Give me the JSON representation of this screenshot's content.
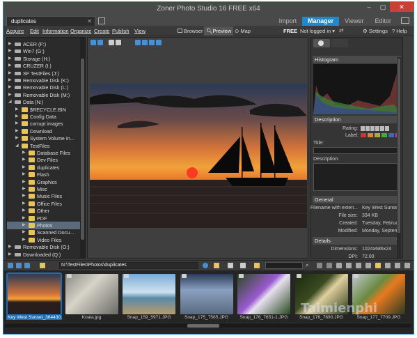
{
  "app": {
    "title": "Zoner Photo Studio 16 FREE x64",
    "doc_tab": "duplicates"
  },
  "modes": [
    {
      "label": "Import"
    },
    {
      "label": "Manager",
      "active": true
    },
    {
      "label": "Viewer"
    },
    {
      "label": "Editor"
    }
  ],
  "menu": [
    "Acquire",
    "Edit",
    "Information",
    "Organize",
    "Create",
    "Publish",
    "View"
  ],
  "viewmodes": [
    "Browser",
    "Preview",
    "Map"
  ],
  "account": {
    "edition": "FREE",
    "login": "Not logged in",
    "settings": "Settings",
    "help": "Help"
  },
  "tree": [
    {
      "label": "ACER (F:)",
      "type": "drive",
      "depth": 1
    },
    {
      "label": "Win7 (G:)",
      "type": "drive",
      "depth": 1
    },
    {
      "label": "Storage (H:)",
      "type": "drive",
      "depth": 1
    },
    {
      "label": "CRUZER (I:)",
      "type": "drive",
      "depth": 1
    },
    {
      "label": "SF TestFiles (J:)",
      "type": "drive",
      "depth": 1
    },
    {
      "label": "Removable Disk (K:)",
      "type": "drive",
      "depth": 1
    },
    {
      "label": "Removable Disk (L:)",
      "type": "drive",
      "depth": 1
    },
    {
      "label": "Removable Disk (M:)",
      "type": "drive",
      "depth": 1
    },
    {
      "label": "Data (N:)",
      "type": "drive",
      "depth": 1,
      "expanded": true
    },
    {
      "label": "$RECYCLE.BIN",
      "type": "folder",
      "depth": 2
    },
    {
      "label": "Config Data",
      "type": "folder",
      "depth": 2
    },
    {
      "label": "corrupt images",
      "type": "folder",
      "depth": 2
    },
    {
      "label": "Download",
      "type": "folder",
      "depth": 2
    },
    {
      "label": "System Volume In...",
      "type": "folder",
      "depth": 2
    },
    {
      "label": "TestFiles",
      "type": "folder",
      "depth": 2,
      "expanded": true
    },
    {
      "label": "Database Files",
      "type": "folder",
      "depth": 3
    },
    {
      "label": "Dev Files",
      "type": "folder",
      "depth": 3
    },
    {
      "label": "duplicates",
      "type": "folder",
      "depth": 3
    },
    {
      "label": "Flash",
      "type": "folder",
      "depth": 3
    },
    {
      "label": "Graphics",
      "type": "folder",
      "depth": 3
    },
    {
      "label": "Misc",
      "type": "folder",
      "depth": 3
    },
    {
      "label": "Music Files",
      "type": "folder",
      "depth": 3
    },
    {
      "label": "Office Files",
      "type": "folder",
      "depth": 3
    },
    {
      "label": "Other",
      "type": "folder",
      "depth": 3
    },
    {
      "label": "PDF",
      "type": "folder",
      "depth": 3
    },
    {
      "label": "Photos",
      "type": "folder",
      "depth": 3,
      "selected": true
    },
    {
      "label": "Scanned Docu...",
      "type": "folder",
      "depth": 3
    },
    {
      "label": "Video Files",
      "type": "folder",
      "depth": 3
    },
    {
      "label": "Removable Disk (O:)",
      "type": "drive",
      "depth": 1
    },
    {
      "label": "Downloaded (Q:)",
      "type": "drive",
      "depth": 1
    }
  ],
  "panel": {
    "histogram": "Histogram",
    "description": "Description",
    "rating_label": "Rating:",
    "label_label": "Label:",
    "title_label": "Title:",
    "desc_label": "Description:",
    "general": "General",
    "details": "Details",
    "general_rows": [
      {
        "k": "Filename with exten...",
        "v": "Key West Sunset_3"
      },
      {
        "k": "File size:",
        "v": "334 KB"
      },
      {
        "k": "Created:",
        "v": "Tuesday, February"
      },
      {
        "k": "Modified:",
        "v": "Monday, Septemb"
      }
    ],
    "details_rows": [
      {
        "k": "Dimensions:",
        "v": "1024x686x24"
      },
      {
        "k": "DPI:",
        "v": "72.00"
      }
    ]
  },
  "address": {
    "path": "N:\\TestFiles\\Photos\\duplicates"
  },
  "thumbs": [
    {
      "caption": "Key West Sunset_364430...",
      "selected": true
    },
    {
      "caption": "Koala.jpg"
    },
    {
      "caption": "Snap_159_5971.JPG"
    },
    {
      "caption": "Snap_175_7565.JPG"
    },
    {
      "caption": "Snap_176_7651-1.JPG"
    },
    {
      "caption": "Snap_176_7690.JPG"
    },
    {
      "caption": "Snap_177_7709.JPG"
    }
  ],
  "watermark": "Taimienphi",
  "colors": {
    "accent": "#1e88d0",
    "close": "#c84038",
    "folder": "#e8c45a",
    "selection": "#1c6fb6"
  }
}
